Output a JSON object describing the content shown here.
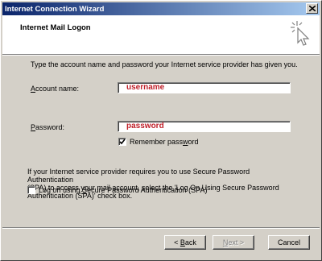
{
  "window": {
    "title": "Internet Connection Wizard"
  },
  "header": {
    "title": "Internet Mail Logon"
  },
  "intro": {
    "text": "Type the account name and password your Internet service provider has given you."
  },
  "account": {
    "label_pre": "",
    "label_key": "A",
    "label_post": "ccount name:",
    "value": "username"
  },
  "password": {
    "label_pre": "",
    "label_key": "P",
    "label_post": "assword:",
    "value": "password"
  },
  "remember": {
    "label_pre": "Remember pass",
    "label_key": "w",
    "label_post": "ord",
    "checked": true
  },
  "spa": {
    "description_lines": [
      "If your Internet service provider requires you to use Secure Password Authentication",
      "(SPA) to access your mail account, select the 'Log On Using Secure Password",
      "Authentication (SPA)' check box."
    ],
    "checkbox_pre": "Log on using ",
    "checkbox_key": "S",
    "checkbox_post": "ecure Password Authentication (SPA)",
    "checked": false
  },
  "buttons": {
    "back_arrow": "<",
    "back_key": "B",
    "back_rest": "ack",
    "next_pre": "",
    "next_key": "N",
    "next_rest": "ext",
    "next_arrow": ">",
    "cancel": "Cancel"
  }
}
